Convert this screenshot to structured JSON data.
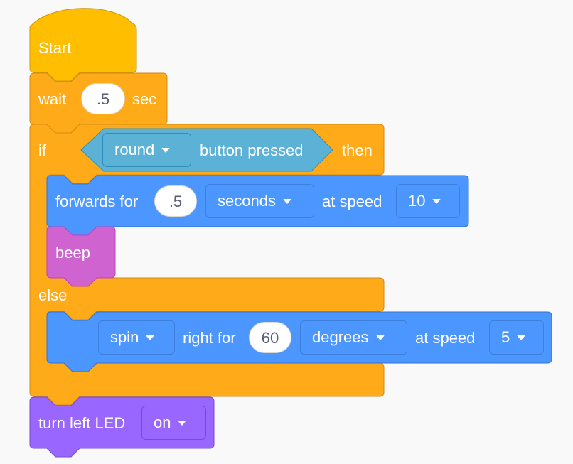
{
  "colors": {
    "events": "#FFBF00",
    "control": "#FFAB19",
    "motion": "#4C97FF",
    "sound": "#CF63CF",
    "sensing": "#5CB1D6",
    "looks": "#9966FF",
    "background": "#F9F9F9"
  },
  "script": {
    "start": {
      "label": "Start"
    },
    "wait": {
      "label": "wait",
      "value": ".5",
      "unit": "sec"
    },
    "if_else": {
      "if_label": "if",
      "then_label": "then",
      "else_label": "else",
      "condition": {
        "button_dropdown": "round",
        "label": "button pressed"
      },
      "then_branch": {
        "forwards": {
          "label": "forwards for",
          "duration": ".5",
          "unit_dropdown": "seconds",
          "speed_label": "at speed",
          "speed_dropdown": "10"
        },
        "beep": {
          "label": "beep"
        }
      },
      "else_branch": {
        "spin": {
          "mode_dropdown": "spin",
          "label": "right for",
          "amount": "60",
          "unit_dropdown": "degrees",
          "speed_label": "at speed",
          "speed_dropdown": "5"
        }
      }
    },
    "led": {
      "label": "turn left LED",
      "state_dropdown": "on"
    }
  }
}
